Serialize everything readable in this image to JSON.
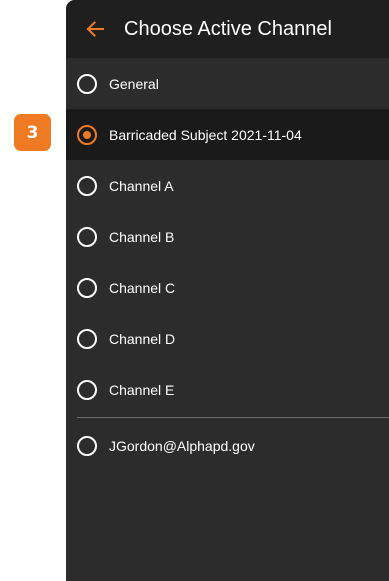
{
  "step_badge": "3",
  "header": {
    "title": "Choose Active Channel",
    "back_icon": "arrow-left-icon"
  },
  "colors": {
    "accent": "#f07a22",
    "panel_background": "#2c2c2c",
    "header_background": "#1f1f1f",
    "selected_row_background": "#1a1a1a"
  },
  "channels": [
    {
      "label": "General",
      "selected": false
    },
    {
      "label": "Barricaded Subject 2021-11-04",
      "selected": true
    },
    {
      "label": "Channel A",
      "selected": false
    },
    {
      "label": "Channel B",
      "selected": false
    },
    {
      "label": "Channel C",
      "selected": false
    },
    {
      "label": "Channel D",
      "selected": false
    },
    {
      "label": "Channel E",
      "selected": false
    }
  ],
  "direct_contacts": [
    {
      "label": "JGordon@Alphapd.gov",
      "selected": false
    }
  ]
}
